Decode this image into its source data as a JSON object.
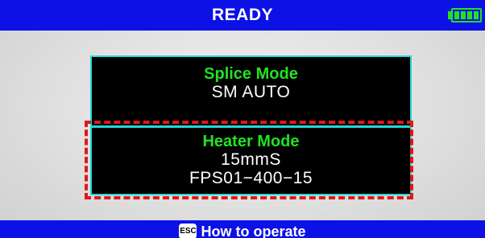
{
  "header": {
    "title": "READY"
  },
  "splice_mode": {
    "title": "Splice Mode",
    "value": "SM AUTO"
  },
  "heater_mode": {
    "title": "Heater Mode",
    "value_line1": "15mmS",
    "value_line2": "FPS01−400−15"
  },
  "footer": {
    "esc_key": "ESC",
    "label": "How to operate"
  },
  "colors": {
    "bar_blue": "#0c11e6",
    "title_green": "#22e222",
    "panel_border": "#23d6d6",
    "highlight_red": "#e01818",
    "battery_green": "#1fe21f"
  },
  "icons": {
    "battery": "battery-full-icon",
    "esc": "esc-key-icon"
  }
}
